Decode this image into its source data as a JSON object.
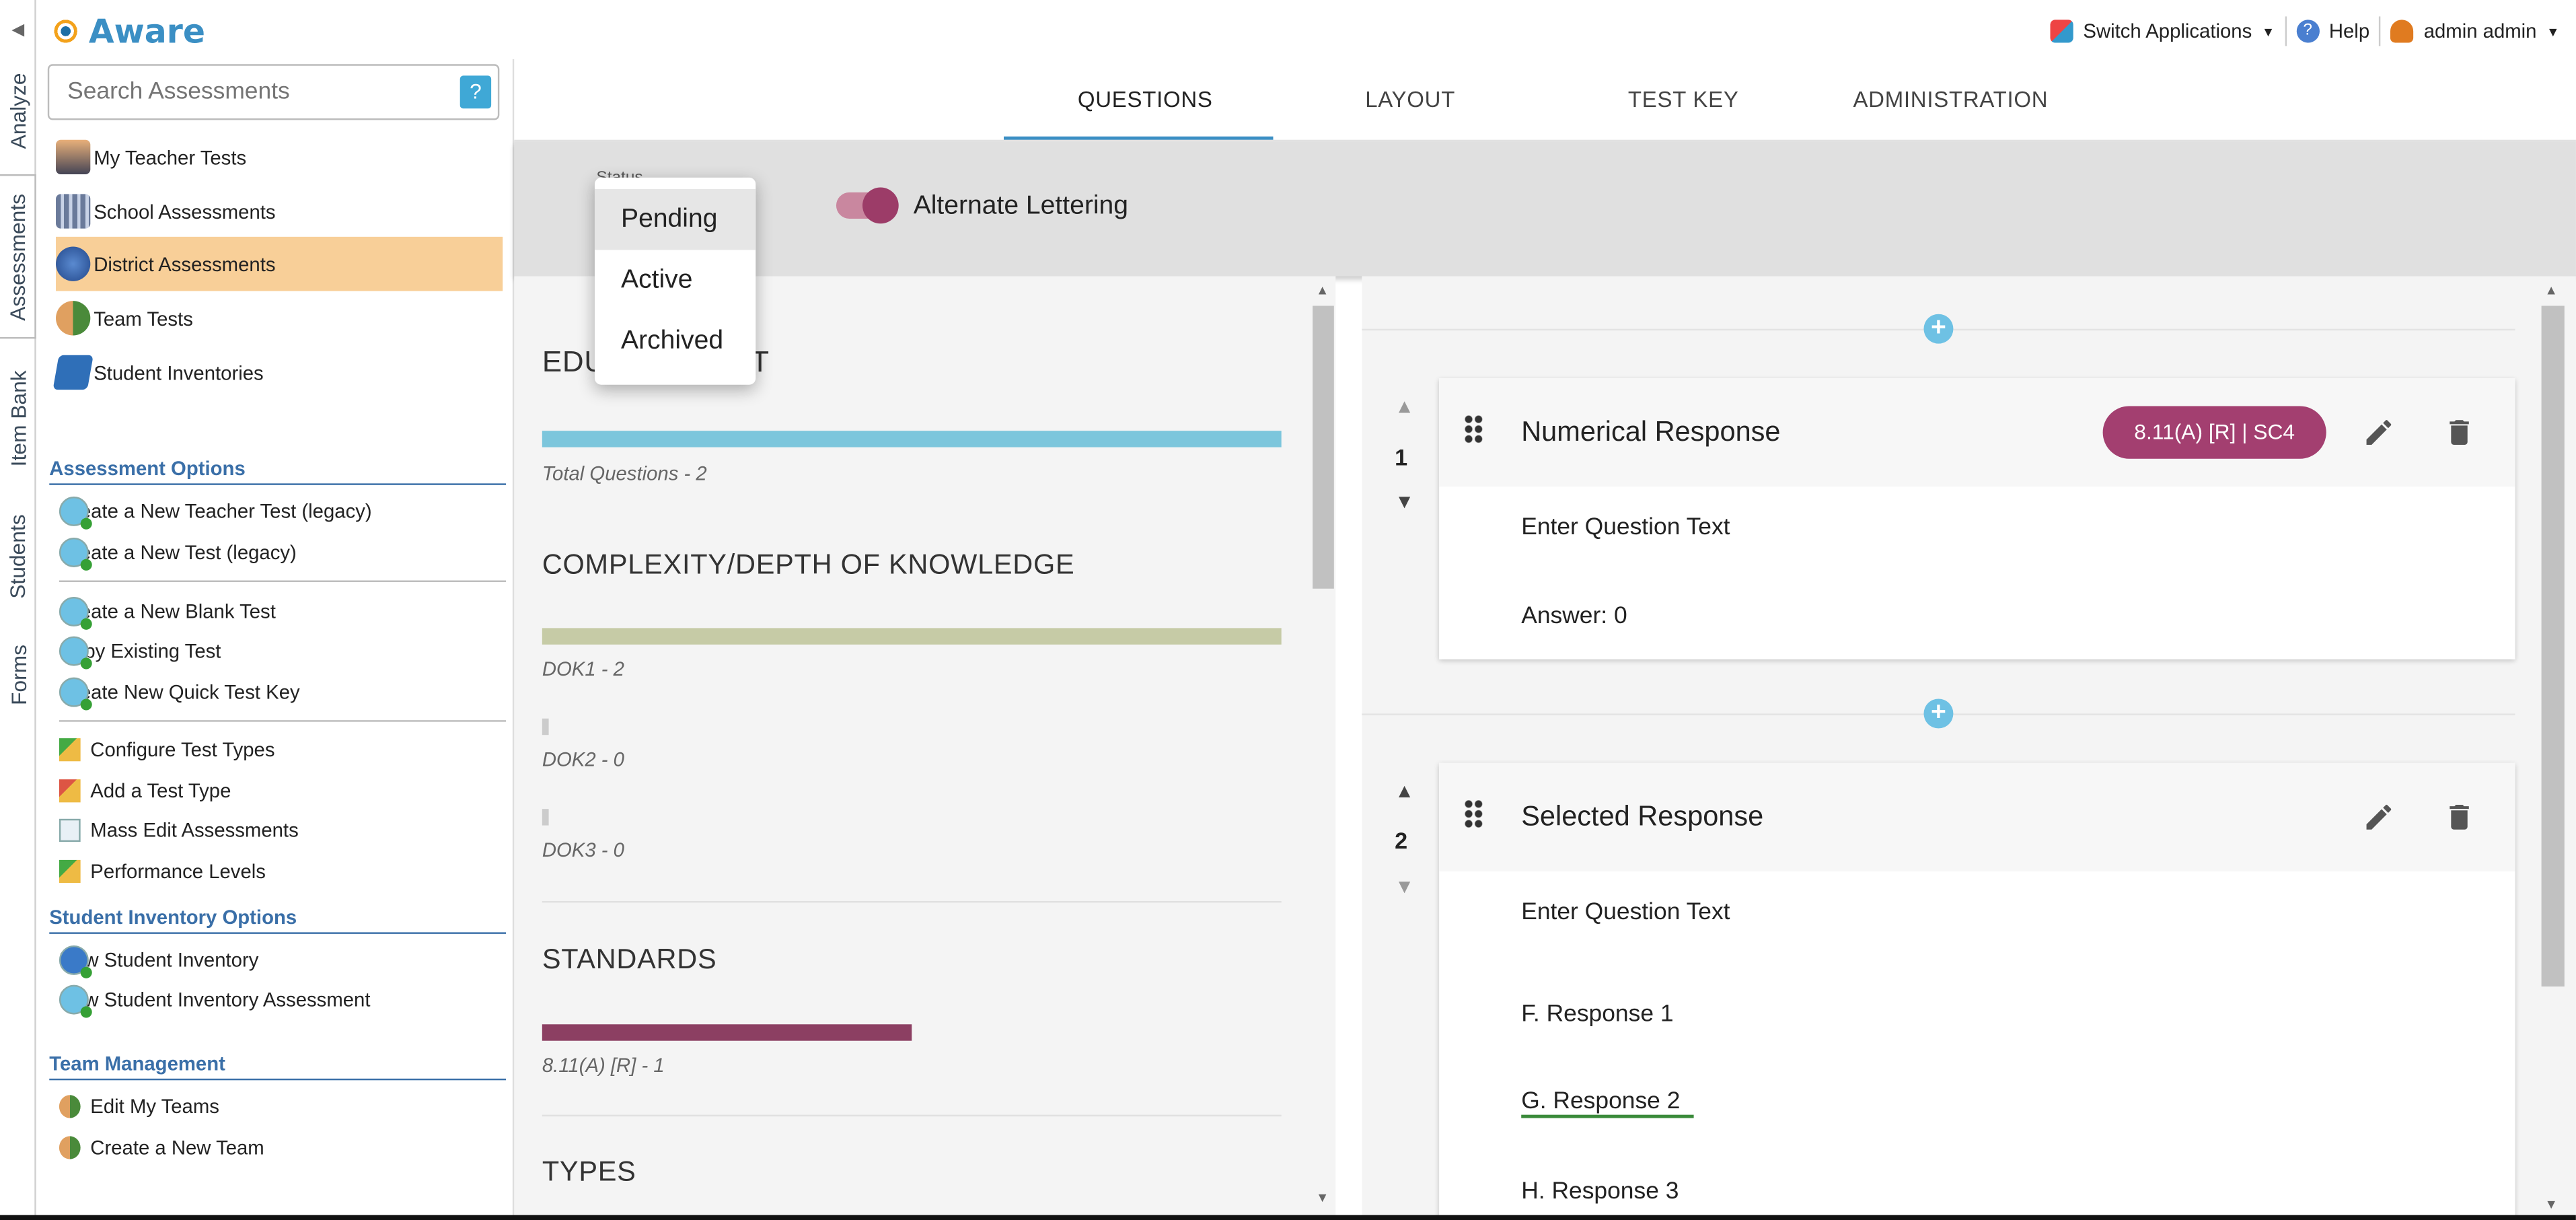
{
  "app": {
    "name": "Aware",
    "switch": "Switch Applications",
    "help": "Help",
    "user": "admin admin"
  },
  "rail": [
    "Analyze",
    "Assessments",
    "Item Bank",
    "Students",
    "Forms"
  ],
  "search": {
    "placeholder": "Search Assessments",
    "help": "?"
  },
  "nav": [
    "My Teacher Tests",
    "School Assessments",
    "District Assessments",
    "Team Tests",
    "Student Inventories"
  ],
  "options": {
    "assessment_header": "Assessment Options",
    "g1": [
      "Create a New Teacher Test (legacy)",
      "Create a New Test (legacy)"
    ],
    "g2": [
      "Create a New Blank Test",
      "Copy Existing Test",
      "Create New Quick Test Key"
    ],
    "g3": [
      "Configure Test Types",
      "Add a Test Type",
      "Mass Edit Assessments",
      "Performance Levels"
    ],
    "inventory_header": "Student Inventory Options",
    "g4": [
      "New Student Inventory",
      "New Student Inventory Assessment"
    ],
    "team_header": "Team Management",
    "g5": [
      "Edit My Teams",
      "Create a New Team"
    ]
  },
  "tabs": [
    "QUESTIONS",
    "LAYOUT",
    "TEST KEY",
    "ADMINISTRATION"
  ],
  "toolbar": {
    "status_label": "Status",
    "alt_lettering": "Alternate Lettering",
    "menu": [
      "Pending",
      "Active",
      "Archived"
    ]
  },
  "summary": {
    "title": "EDU            EST",
    "total": "Total Questions - 2",
    "complexity": "COMPLEXITY/DEPTH OF KNOWLEDGE",
    "dok": [
      "DOK1 - 2",
      "DOK2 - 0",
      "DOK3 - 0"
    ],
    "standards": "STANDARDS",
    "std_item": "8.11(A) [R] - 1",
    "types": "TYPES"
  },
  "questions": [
    {
      "num": "1",
      "title": "Numerical Response",
      "badge": "8.11(A) [R]  |  SC4",
      "text": "Enter Question Text",
      "answer": "Answer: 0"
    },
    {
      "num": "2",
      "title": "Selected Response",
      "text": "Enter Question Text",
      "responses": [
        "F.  Response 1",
        "G.  Response 2",
        "H.  Response 3"
      ]
    }
  ],
  "colors": {
    "accent": "#3b8fc4",
    "badge": "#a33f70",
    "selected_nav": "#f8cf98"
  }
}
